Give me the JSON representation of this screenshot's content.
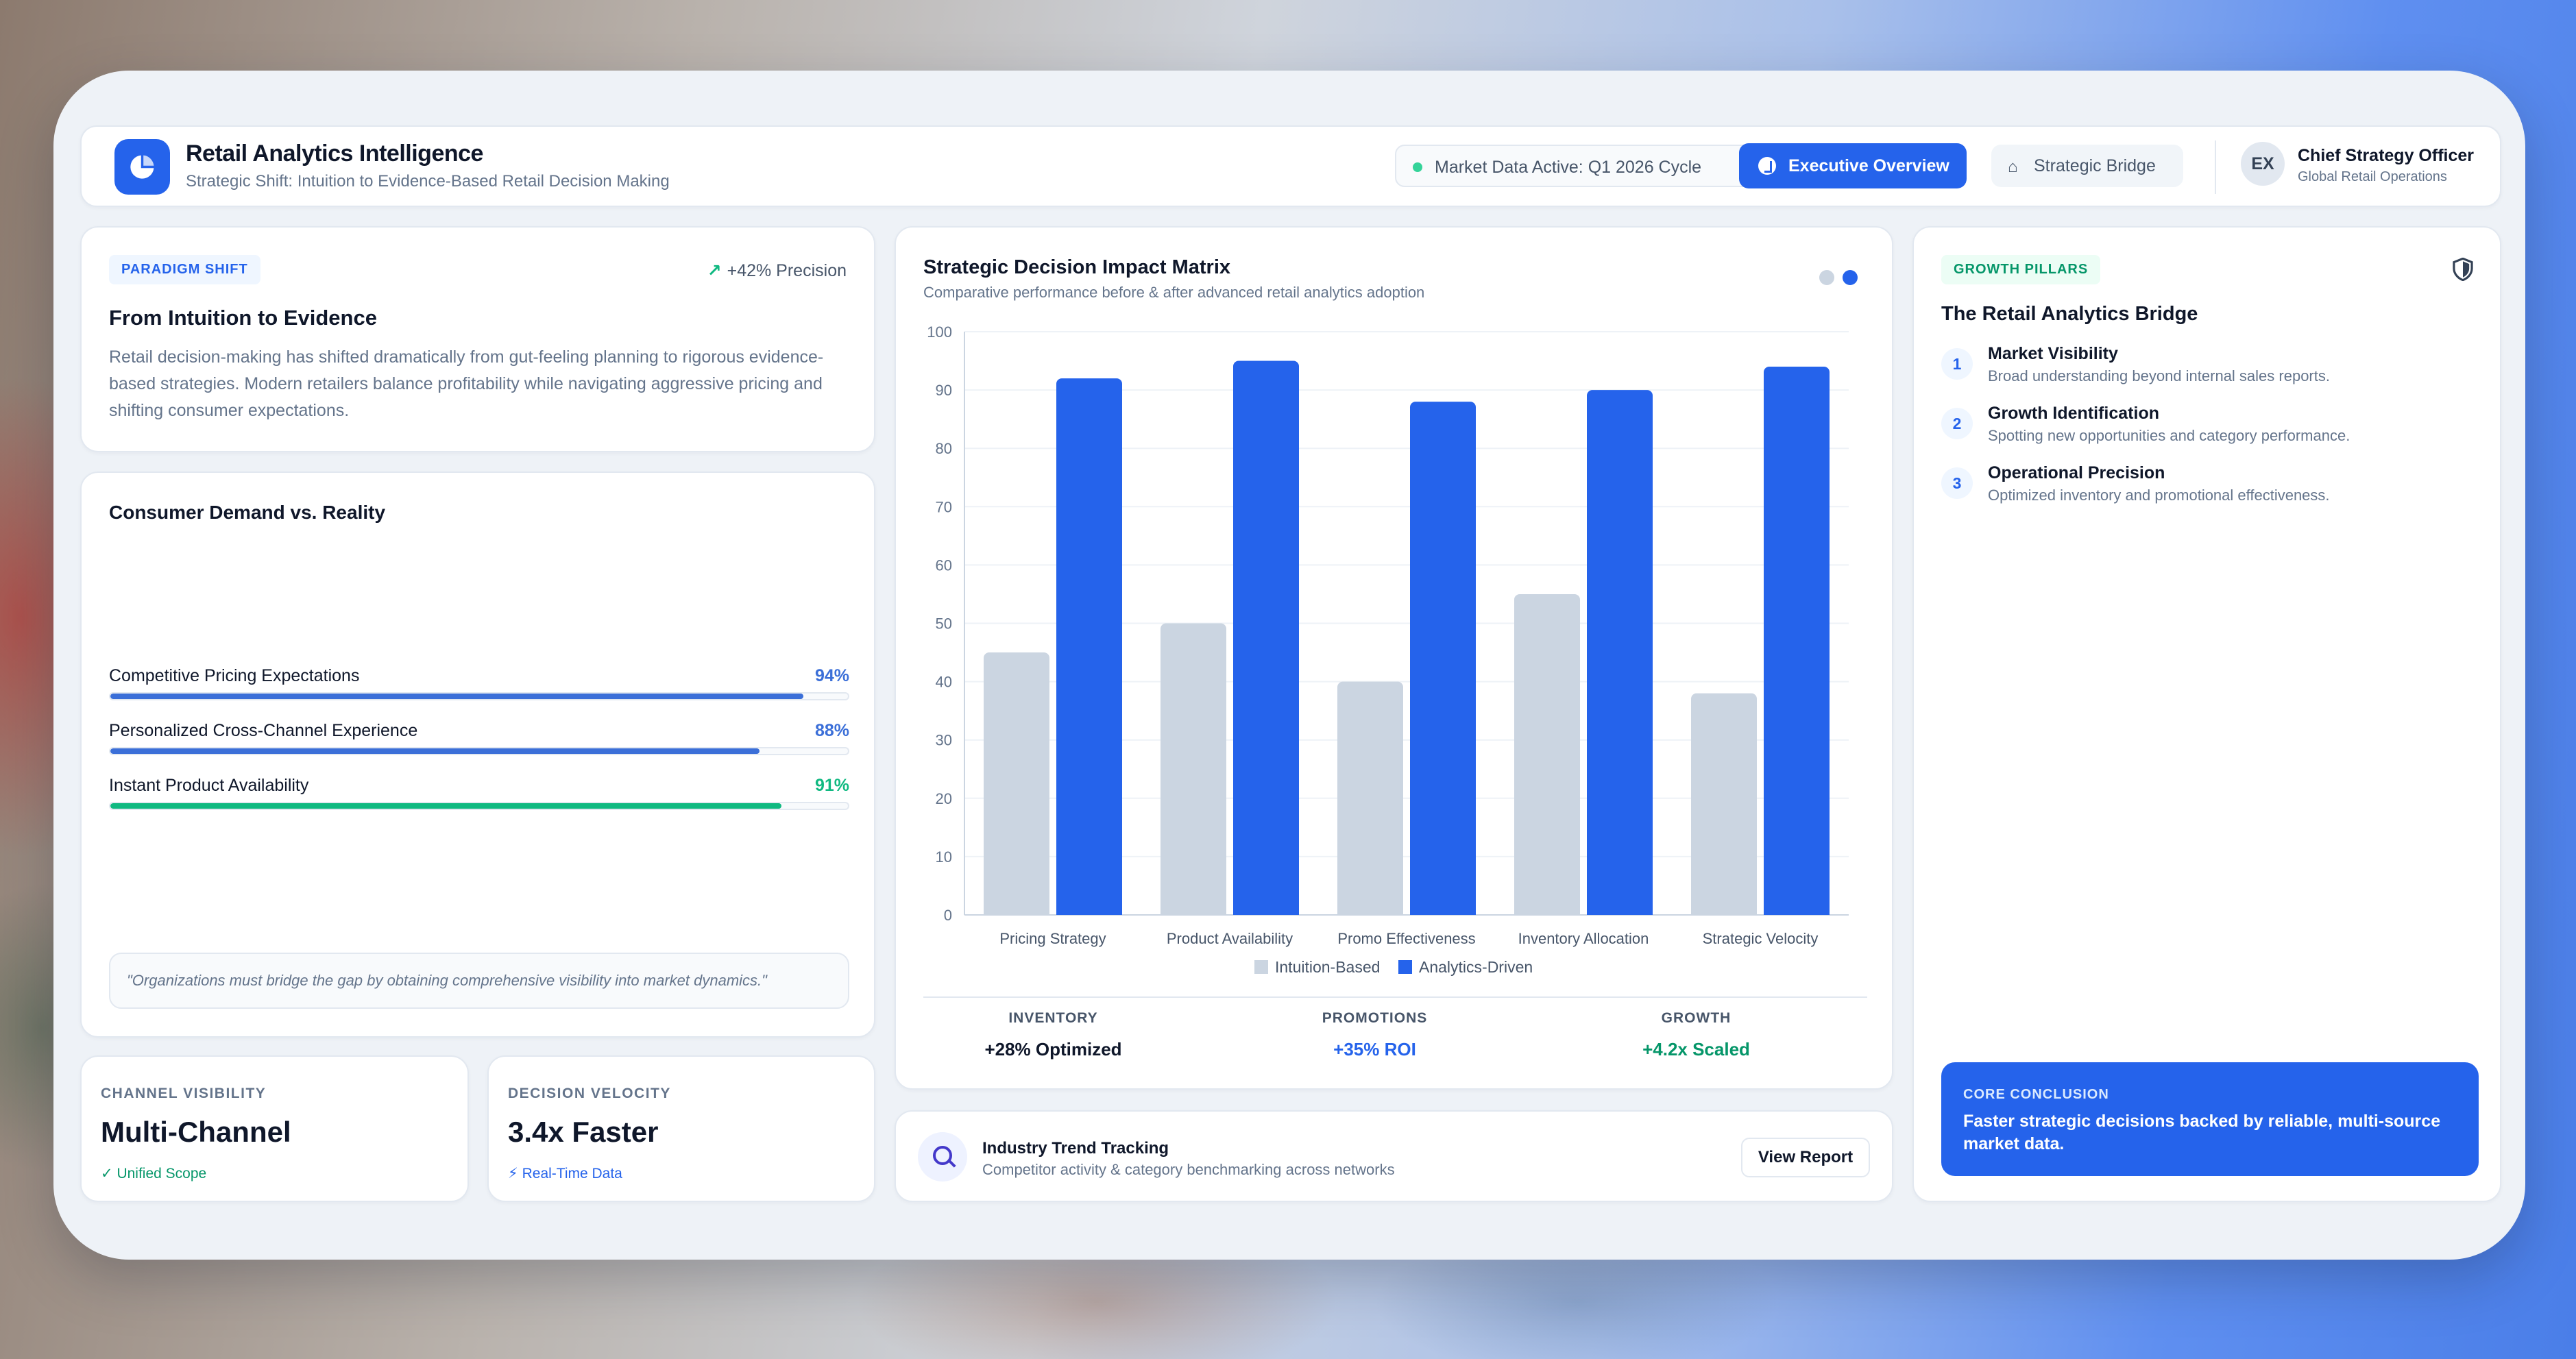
{
  "header": {
    "title": "Retail Analytics Intelligence",
    "subtitle": "Strategic Shift: Intuition to Evidence-Based Retail Decision Making",
    "status": "Market Data Active: Q1 2026 Cycle",
    "tabs": [
      {
        "label": "Executive Overview",
        "active": true
      },
      {
        "label": "Strategic Bridge",
        "active": false
      }
    ],
    "user": {
      "initials": "EX",
      "role": "Chief Strategy Officer",
      "org": "Global Retail Operations"
    }
  },
  "paradigm": {
    "badge": "PARADIGM SHIFT",
    "metric": "+42% Precision",
    "title": "From Intuition to Evidence",
    "body": "Retail decision-making has shifted dramatically from gut-feeling planning to rigorous evidence-based strategies. Modern retailers balance profitability while navigating aggressive pricing and shifting consumer expectations."
  },
  "demand": {
    "title": "Consumer Demand vs. Reality",
    "items": [
      {
        "label": "Competitive Pricing Expectations",
        "pct_text": "94%",
        "value": 94,
        "color": "#3b6fd8"
      },
      {
        "label": "Personalized Cross-Channel Experience",
        "pct_text": "88%",
        "value": 88,
        "color": "#3b6fd8"
      },
      {
        "label": "Instant Product Availability",
        "pct_text": "91%",
        "value": 91,
        "color": "#10b981"
      }
    ],
    "quote": "\"Organizations must bridge the gap by obtaining comprehensive visibility into market dynamics.\""
  },
  "stats": [
    {
      "kicker": "CHANNEL VISIBILITY",
      "value": "Multi-Channel",
      "note": "Unified Scope",
      "note_color": "#059669"
    },
    {
      "kicker": "DECISION VELOCITY",
      "value": "3.4x Faster",
      "note": "Real-Time Data",
      "note_color": "#2563eb"
    }
  ],
  "chart_card": {
    "title": "Strategic Decision Impact Matrix",
    "subtitle": "Comparative performance before & after advanced retail analytics adoption",
    "kpis": [
      {
        "label": "INVENTORY",
        "value": "+28% Optimized",
        "color": "#0f172a"
      },
      {
        "label": "PROMOTIONS",
        "value": "+35% ROI",
        "color": "#2563eb"
      },
      {
        "label": "GROWTH",
        "value": "+4.2x Scaled",
        "color": "#059669"
      }
    ]
  },
  "chart_data": {
    "type": "bar",
    "categories": [
      "Pricing Strategy",
      "Product Availability",
      "Promo Effectiveness",
      "Inventory Allocation",
      "Strategic Velocity"
    ],
    "series": [
      {
        "name": "Intuition-Based",
        "color": "#cbd5e1",
        "values": [
          45,
          50,
          40,
          55,
          38
        ]
      },
      {
        "name": "Analytics-Driven",
        "color": "#2563eb",
        "values": [
          92,
          95,
          88,
          90,
          94
        ]
      }
    ],
    "ylim": [
      0,
      100
    ],
    "yticks": [
      0,
      10,
      20,
      30,
      40,
      50,
      60,
      70,
      80,
      90,
      100
    ],
    "legend": "bottom",
    "grid": true
  },
  "trend": {
    "title": "Industry Trend Tracking",
    "subtitle": "Competitor activity & category benchmarking across networks",
    "button": "View Report"
  },
  "pillars": {
    "badge": "GROWTH PILLARS",
    "title": "The Retail Analytics Bridge",
    "items": [
      {
        "num": "1",
        "title": "Market Visibility",
        "desc": "Broad understanding beyond internal sales reports."
      },
      {
        "num": "2",
        "title": "Growth Identification",
        "desc": "Spotting new opportunities and category performance."
      },
      {
        "num": "3",
        "title": "Operational Precision",
        "desc": "Optimized inventory and promotional effectiveness."
      }
    ],
    "conclusion_label": "CORE CONCLUSION",
    "conclusion_text": "Faster strategic decisions backed by reliable, multi-source market data."
  }
}
